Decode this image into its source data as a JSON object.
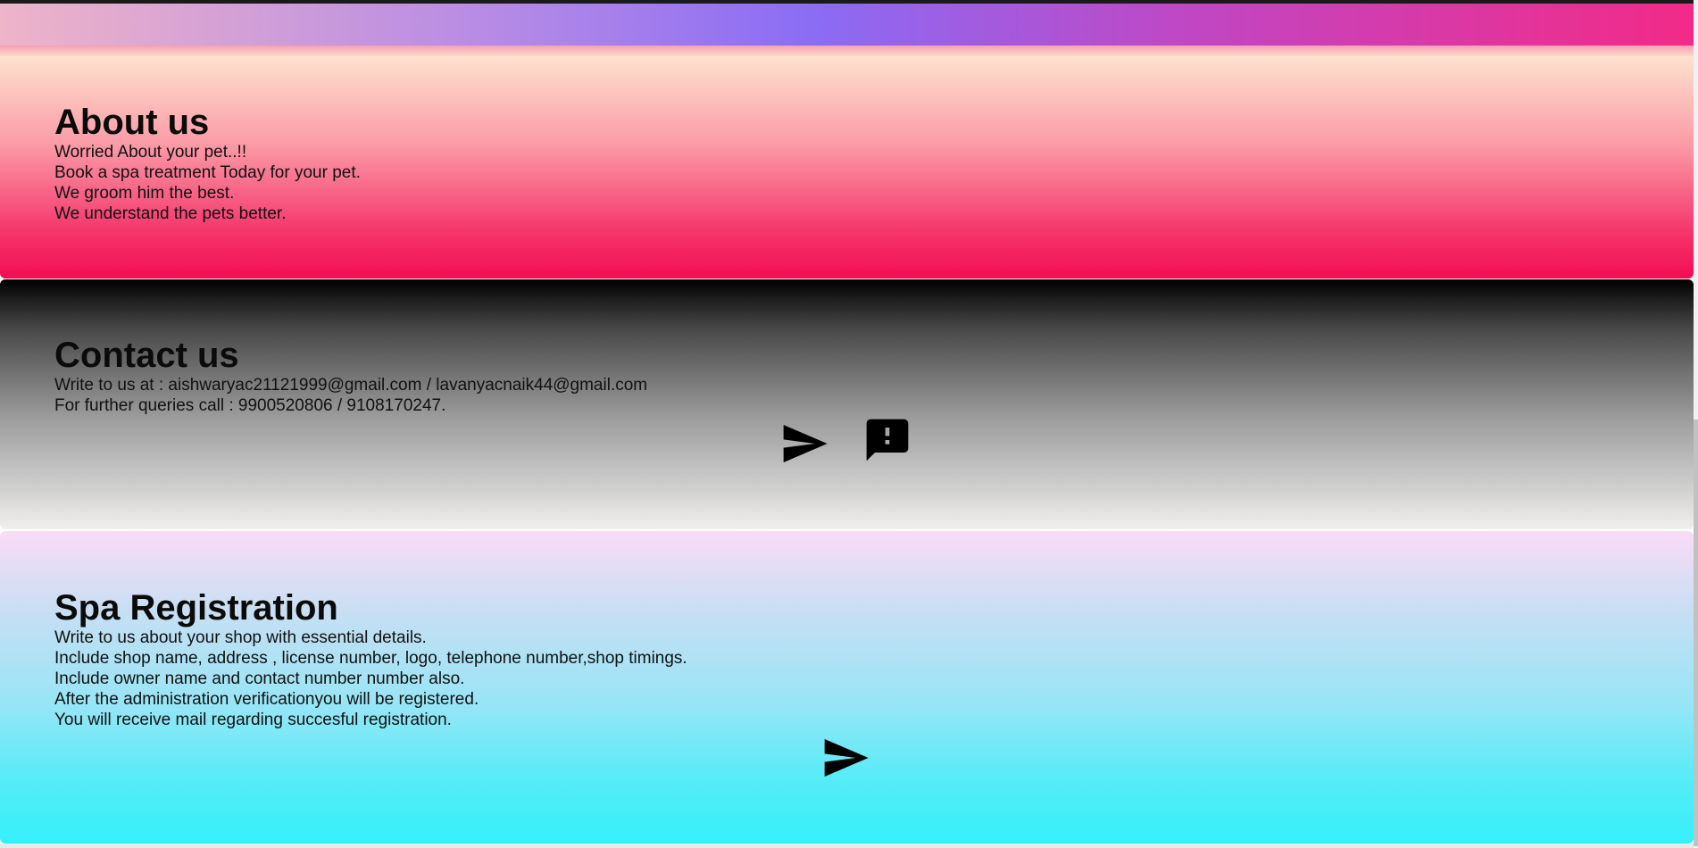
{
  "about": {
    "heading": "About us",
    "lines": [
      "Worried About your pet..!!",
      "Book a spa treatment Today for your pet.",
      "We groom him the best.",
      "We understand the pets better."
    ]
  },
  "contact": {
    "heading": "Contact us",
    "lines": [
      "Write to us at : aishwaryac21121999@gmail.com / lavanyacnaik44@gmail.com",
      "For further queries call : 9900520806 / 9108170247."
    ],
    "icons": [
      "send-icon",
      "feedback-icon"
    ]
  },
  "spa": {
    "heading": "Spa Registration",
    "lines": [
      "Write to us about your shop with essential details.",
      "Include shop name, address , license number, logo, telephone number,shop timings.",
      "Include owner name and contact number number also.",
      "After the administration verificationyou will be registered.",
      "You will receive mail regarding succesful registration."
    ],
    "icons": [
      "send-icon"
    ]
  }
}
